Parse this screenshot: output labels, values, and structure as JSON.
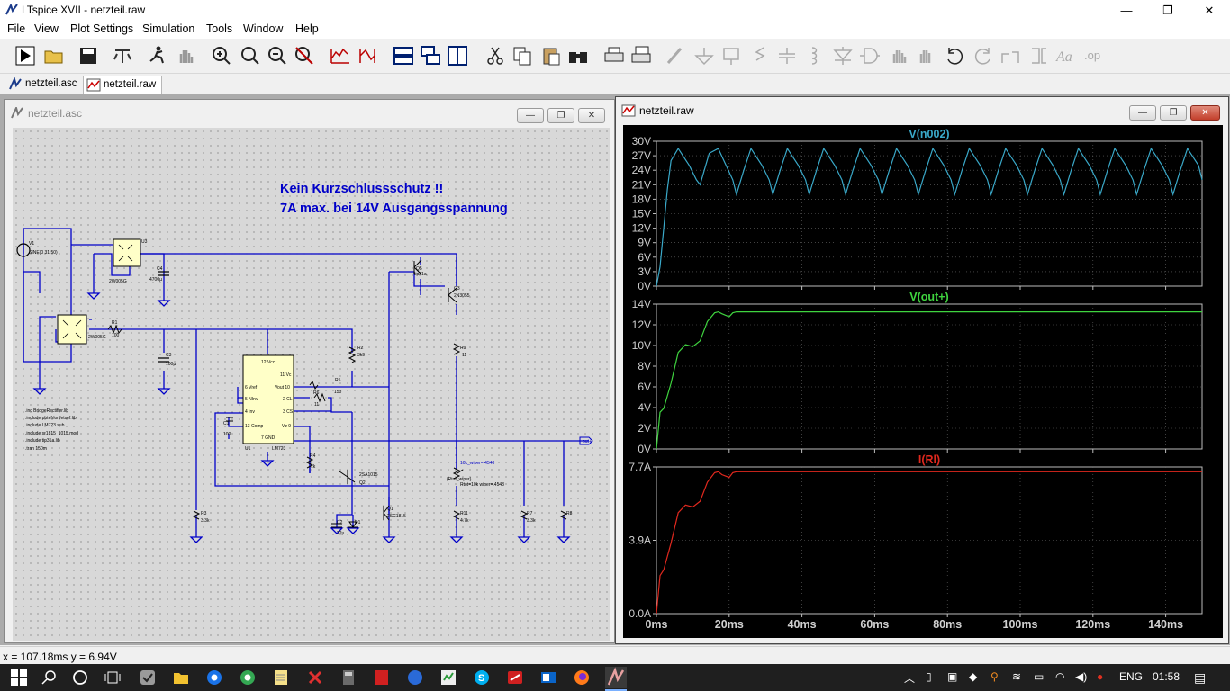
{
  "window": {
    "title": "LTspice XVII - netzteil.raw",
    "minimize": "—",
    "maximize": "❐",
    "close": "✕"
  },
  "menu": [
    "File",
    "View",
    "Plot Settings",
    "Simulation",
    "Tools",
    "Window",
    "Help"
  ],
  "toolbar": {
    "icons": [
      "run-icon",
      "open-folder-icon",
      "save-icon",
      "control-panel-icon",
      "halt-icon",
      "pan-hand-icon",
      "zoom-in-icon",
      "zoom-area-icon",
      "zoom-out-icon",
      "zoom-cancel-icon",
      "autorange-icon",
      "mark-icon",
      "tile-horizontal-icon",
      "cascade-icon",
      "tile-vertical-icon",
      "cut-icon",
      "copy-icon",
      "paste-icon",
      "find-icon",
      "print-icon",
      "print-setup-icon",
      "draw-wire-icon",
      "ground-icon",
      "label-net-icon",
      "resistor-icon",
      "capacitor-icon",
      "inductor-icon",
      "diode-icon",
      "component-icon",
      "move-icon",
      "drag-icon",
      "undo-icon",
      "redo-icon",
      "rotate-icon",
      "mirror-icon",
      "text-icon",
      "spice-directive-icon"
    ]
  },
  "tabs": [
    {
      "label": "netzteil.asc",
      "icon": "schematic-tab-icon",
      "active": false
    },
    {
      "label": "netzteil.raw",
      "icon": "waveform-tab-icon",
      "active": true
    }
  ],
  "schematic_window": {
    "title": "netzteil.asc",
    "annotation_line1": "Kein Kurzschlussschutz !!",
    "annotation_line2": "7A max.  bei 14V Ausgangsspannung",
    "directives": [
      ".inc BridgeRectifier.lib",
      ".include pbtefrlonfetsef.lib",
      ".include LM723.sub",
      ".include sr1815_1015.mod",
      ".include tip31a.lib",
      ".tran 150m"
    ],
    "labels": {
      "v1": "V1",
      "v1_val": "SINE(0 31 50)",
      "u3": "U3",
      "u3_val": "2W005G",
      "u2_val": "2W005G",
      "c4": "C4",
      "c4_val": "4700µ",
      "c3": "C3",
      "c3_val": "100µ",
      "r1": "R1",
      "r1_val": "100",
      "q5": "Q5",
      "q5_val": "tip31a",
      "q3": "Q3",
      "q3_val": "2N3055",
      "r9": "R9",
      "r9_val": "11",
      "r2": "R2",
      "r2_val": "3k9",
      "r5": "R5",
      "r5_val": "150",
      "r6": "R6",
      "r6_val": "11",
      "r4": "R4",
      "r4_val": "1k",
      "r3": "R3",
      "r3_val": "3.3k",
      "r7": "R7",
      "r7_val": "3.3k",
      "r8": "R8",
      "r11": "R11",
      "r11_val": "4.7k",
      "q2": "Q2",
      "q2_val": "2SA1015",
      "q1": "Q1",
      "q1_val": "2SC1815",
      "c1": "C1",
      "c1_val": "100",
      "c2": "C2",
      "c2_val": "22µ",
      "d1": "D1",
      "u1": "U1",
      "u1_val": "LM723",
      "pot_top": "{Rtot_wiper}",
      "pot_val": "10k_wiper=.4548",
      "pot_bot": "Rtot=10k wiper=.4548",
      "out_label": "out+",
      "ic_pins": {
        "vcc": "12 Vcc",
        "vc": "11 Vc",
        "vref": "6 Vref",
        "ninv": "5 NInv",
        "vout": "Vout 10",
        "cl": "2 CL",
        "inv": "4 Inv",
        "cs": "3 CS",
        "comp": "13 Comp",
        "vz": "Vz 9",
        "gnd": "7 GND"
      }
    }
  },
  "waveform_window": {
    "title": "netzteil.raw",
    "x_axis_ticks": [
      "0ms",
      "20ms",
      "40ms",
      "60ms",
      "80ms",
      "100ms",
      "120ms",
      "140ms"
    ],
    "plots": [
      {
        "trace": "V(n002)",
        "color": "#3aa9c9",
        "yticks": [
          "30V",
          "27V",
          "24V",
          "21V",
          "18V",
          "15V",
          "12V",
          "9V",
          "6V",
          "3V",
          "0V"
        ]
      },
      {
        "trace": "V(out+)",
        "color": "#3fd43f",
        "yticks": [
          "14V",
          "12V",
          "10V",
          "8V",
          "6V",
          "4V",
          "2V",
          "0V"
        ]
      },
      {
        "trace": "I(Rl)",
        "color": "#e0281e",
        "yticks": [
          "7.7A",
          "3.9A",
          "0.0A"
        ]
      }
    ]
  },
  "chart_data": [
    {
      "type": "line",
      "title": "V(n002)",
      "series": [
        {
          "name": "V(n002)",
          "x": [
            0,
            1,
            2,
            3,
            4,
            6,
            9,
            11,
            12,
            14.5,
            17,
            21,
            22,
            24,
            26,
            29,
            31,
            32,
            34,
            36,
            39,
            41,
            42,
            44,
            46,
            49,
            51,
            52,
            54,
            56,
            59,
            61,
            62,
            64,
            66,
            69,
            71,
            72,
            74,
            76,
            79,
            81,
            82,
            84,
            86,
            89,
            91,
            92,
            94,
            96,
            99,
            101,
            102,
            104,
            106,
            109,
            111,
            112,
            114,
            116,
            119,
            121,
            122,
            124,
            126,
            129,
            131,
            132,
            134,
            136,
            139,
            141,
            142,
            144,
            146,
            149,
            150
          ],
          "y": [
            0,
            4,
            12,
            20,
            26,
            28.5,
            25,
            22,
            21,
            27.5,
            28.5,
            22,
            19,
            24,
            28.5,
            25,
            22,
            19,
            24,
            28.5,
            25,
            22,
            19,
            24,
            28.5,
            25,
            22,
            19,
            24,
            28.5,
            25,
            22,
            19,
            24,
            28.5,
            25,
            22,
            19,
            24,
            28.5,
            25,
            22,
            19,
            24,
            28.5,
            25,
            22,
            19,
            24,
            28.5,
            25,
            22,
            19,
            24,
            28.5,
            25,
            22,
            19,
            24,
            28.5,
            25,
            22,
            19,
            24,
            28.5,
            25,
            22,
            19,
            24,
            28.5,
            25,
            22,
            19,
            24,
            28.5,
            25,
            22
          ]
        }
      ],
      "xlim": [
        0,
        150
      ],
      "ylim": [
        0,
        30
      ]
    },
    {
      "type": "line",
      "title": "V(out+)",
      "series": [
        {
          "name": "V(out+)",
          "x": [
            0,
            1,
            2,
            4,
            6,
            8,
            10,
            12,
            14,
            16,
            17,
            18,
            20,
            21,
            22,
            150
          ],
          "y": [
            0,
            3.8,
            4.2,
            6.8,
            10,
            10.8,
            10.6,
            11.2,
            13.2,
            14.1,
            14.2,
            14.0,
            13.7,
            14.1,
            14.2,
            14.2
          ]
        }
      ],
      "xlim": [
        0,
        150
      ],
      "ylim": [
        0,
        15
      ]
    },
    {
      "type": "line",
      "title": "I(Rl)",
      "series": [
        {
          "name": "I(Rl)",
          "x": [
            0,
            1,
            2,
            4,
            6,
            8,
            10,
            12,
            14,
            16,
            17,
            18,
            20,
            21,
            22,
            150
          ],
          "y": [
            0,
            2.0,
            2.3,
            3.7,
            5.3,
            5.7,
            5.6,
            5.9,
            6.9,
            7.4,
            7.45,
            7.3,
            7.15,
            7.4,
            7.45,
            7.45
          ]
        }
      ],
      "xlim": [
        0,
        150
      ],
      "ylim": [
        0,
        7.7
      ]
    }
  ],
  "status": {
    "cursor": "x = 107.18ms   y = 6.94V"
  },
  "taskbar": {
    "apps": [
      "windows-start-icon",
      "search-icon",
      "cortana-icon",
      "task-view-icon",
      "app1-icon",
      "file-explorer-icon",
      "chrome-icon",
      "chrome-alt-icon",
      "notepad-icon",
      "cross-app-icon",
      "calculator-icon",
      "red-app-icon",
      "app-blue-icon",
      "app-green-icon",
      "skype-icon",
      "pdf-icon",
      "outlook-icon",
      "firefox-icon",
      "ltspice-icon"
    ],
    "tray": {
      "lang": "ENG",
      "time": "01:58"
    }
  }
}
